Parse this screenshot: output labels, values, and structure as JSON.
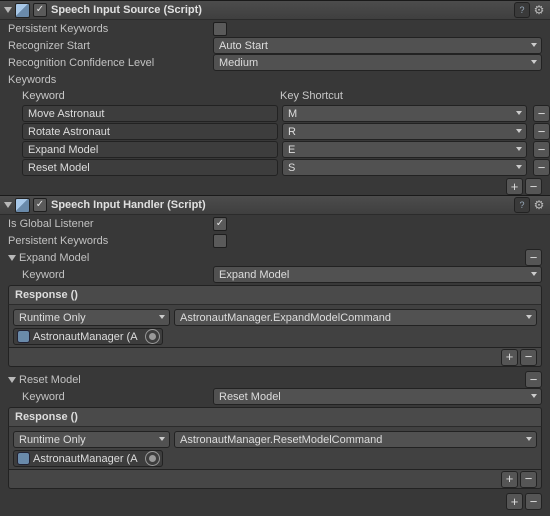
{
  "speech_source": {
    "title": "Speech Input Source (Script)",
    "persistent_label": "Persistent Keywords",
    "recognizer_label": "Recognizer Start",
    "recognizer_value": "Auto Start",
    "confidence_label": "Recognition Confidence Level",
    "confidence_value": "Medium",
    "keywords_label": "Keywords",
    "kw_header_keyword": "Keyword",
    "kw_header_shortcut": "Key Shortcut",
    "keywords": [
      {
        "word": "Move Astronaut",
        "key": "M"
      },
      {
        "word": "Rotate Astronaut",
        "key": "R"
      },
      {
        "word": "Expand Model",
        "key": "E"
      },
      {
        "word": "Reset Model",
        "key": "S"
      }
    ]
  },
  "speech_handler": {
    "title": "Speech Input Handler (Script)",
    "global_label": "Is Global Listener",
    "persistent_label": "Persistent Keywords",
    "sections": [
      {
        "name": "Expand Model",
        "keyword_label": "Keyword",
        "keyword_value": "Expand Model",
        "response_title": "Response ()",
        "runtime": "Runtime Only",
        "method": "AstronautManager.ExpandModelCommand",
        "target": "AstronautManager (A"
      },
      {
        "name": "Reset Model",
        "keyword_label": "Keyword",
        "keyword_value": "Reset Model",
        "response_title": "Response ()",
        "runtime": "Runtime Only",
        "method": "AstronautManager.ResetModelCommand",
        "target": "AstronautManager (A"
      }
    ]
  },
  "icons": {
    "plus": "+",
    "minus": "−",
    "help": "?",
    "gear": "⚙"
  }
}
